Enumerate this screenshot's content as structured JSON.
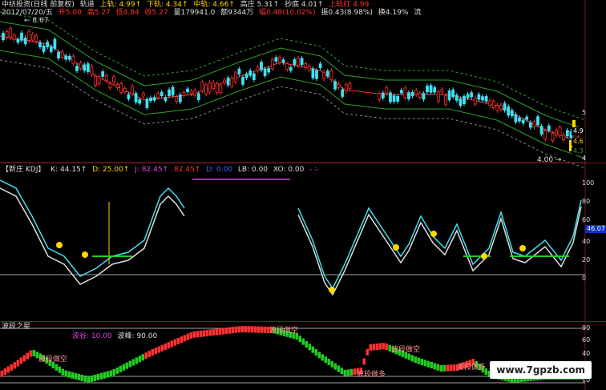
{
  "header": {
    "title": "中纺投资(日线 前复权)",
    "indicator": "轨道",
    "upper_label": "上轨: 4.99↑",
    "lower_label": "下轨: 4.34↑",
    "middle_label": "中轨: 4.66↑",
    "peak_label": "高庄 5.31↑",
    "bottom_label": "抄底 4.01↑",
    "upper_red_label": "上轨红 4.99",
    "date": "2012/07/20/五",
    "open": "开5.00",
    "high": "高5.27",
    "low": "低4.84",
    "close": "收5.27",
    "volume": "量179941.0",
    "amount": "额9344万",
    "change": "幅0.48(10.02%)",
    "amplitude": "振0.43(8.98%)",
    "turnover": "换4.19%",
    "flow": "流"
  },
  "price_panel": {
    "max_label": "8.67",
    "min_label": "4.00",
    "axis": [
      "5",
      "4"
    ],
    "right_values": [
      "4.9",
      "4.6",
      "4.3"
    ],
    "right_tags": [
      "卖",
      "买"
    ]
  },
  "kdj_panel": {
    "title": "【新庄 KDJ】",
    "k": "K: 44.15↑",
    "d": "D: 25.00↑",
    "j": "J: 82.45↑",
    "extra": "82.45↑",
    "dd": "D: 0.00",
    "lb": "LB: 0.00",
    "xo": "XO: 0.00",
    "tail": "- ∶-",
    "axis": [
      "100",
      "80",
      "60",
      "40",
      "20",
      "0"
    ],
    "current": "46.07"
  },
  "wave_panel": {
    "title": "波段之星",
    "valley": "波谷: 10.00",
    "peak": "波峰: 90.00",
    "axis": [
      "90",
      "60",
      "40",
      "20",
      "10"
    ],
    "annotations": [
      "波段做空",
      "波段做空",
      "波段做多",
      "波段做空",
      "波段做多"
    ]
  },
  "watermark": "www.7gpzb.com",
  "colors": {
    "up": "#ff3030",
    "down": "#40e0f0",
    "mid": "#ff3030",
    "band": "#2ea02e",
    "wave_up": "#ff3030",
    "wave_down": "#22cc22",
    "label_red": "#ff3030",
    "label_cyan": "#40e0f0",
    "label_yellow": "#ffd700",
    "label_magenta": "#e040e0"
  }
}
